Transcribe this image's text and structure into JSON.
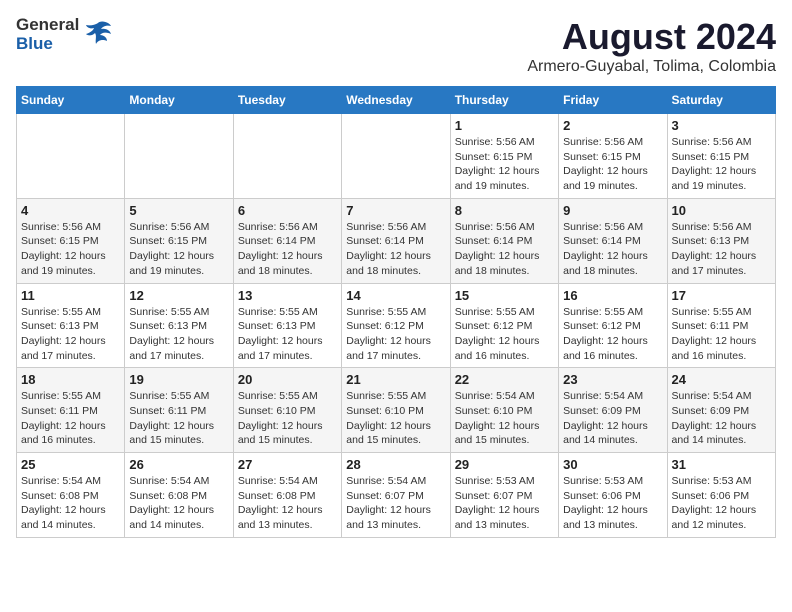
{
  "header": {
    "logo_general": "General",
    "logo_blue": "Blue",
    "month": "August 2024",
    "location": "Armero-Guyabal, Tolima, Colombia"
  },
  "weekdays": [
    "Sunday",
    "Monday",
    "Tuesday",
    "Wednesday",
    "Thursday",
    "Friday",
    "Saturday"
  ],
  "weeks": [
    [
      {
        "day": "",
        "info": ""
      },
      {
        "day": "",
        "info": ""
      },
      {
        "day": "",
        "info": ""
      },
      {
        "day": "",
        "info": ""
      },
      {
        "day": "1",
        "info": "Sunrise: 5:56 AM\nSunset: 6:15 PM\nDaylight: 12 hours\nand 19 minutes."
      },
      {
        "day": "2",
        "info": "Sunrise: 5:56 AM\nSunset: 6:15 PM\nDaylight: 12 hours\nand 19 minutes."
      },
      {
        "day": "3",
        "info": "Sunrise: 5:56 AM\nSunset: 6:15 PM\nDaylight: 12 hours\nand 19 minutes."
      }
    ],
    [
      {
        "day": "4",
        "info": "Sunrise: 5:56 AM\nSunset: 6:15 PM\nDaylight: 12 hours\nand 19 minutes."
      },
      {
        "day": "5",
        "info": "Sunrise: 5:56 AM\nSunset: 6:15 PM\nDaylight: 12 hours\nand 19 minutes."
      },
      {
        "day": "6",
        "info": "Sunrise: 5:56 AM\nSunset: 6:14 PM\nDaylight: 12 hours\nand 18 minutes."
      },
      {
        "day": "7",
        "info": "Sunrise: 5:56 AM\nSunset: 6:14 PM\nDaylight: 12 hours\nand 18 minutes."
      },
      {
        "day": "8",
        "info": "Sunrise: 5:56 AM\nSunset: 6:14 PM\nDaylight: 12 hours\nand 18 minutes."
      },
      {
        "day": "9",
        "info": "Sunrise: 5:56 AM\nSunset: 6:14 PM\nDaylight: 12 hours\nand 18 minutes."
      },
      {
        "day": "10",
        "info": "Sunrise: 5:56 AM\nSunset: 6:13 PM\nDaylight: 12 hours\nand 17 minutes."
      }
    ],
    [
      {
        "day": "11",
        "info": "Sunrise: 5:55 AM\nSunset: 6:13 PM\nDaylight: 12 hours\nand 17 minutes."
      },
      {
        "day": "12",
        "info": "Sunrise: 5:55 AM\nSunset: 6:13 PM\nDaylight: 12 hours\nand 17 minutes."
      },
      {
        "day": "13",
        "info": "Sunrise: 5:55 AM\nSunset: 6:13 PM\nDaylight: 12 hours\nand 17 minutes."
      },
      {
        "day": "14",
        "info": "Sunrise: 5:55 AM\nSunset: 6:12 PM\nDaylight: 12 hours\nand 17 minutes."
      },
      {
        "day": "15",
        "info": "Sunrise: 5:55 AM\nSunset: 6:12 PM\nDaylight: 12 hours\nand 16 minutes."
      },
      {
        "day": "16",
        "info": "Sunrise: 5:55 AM\nSunset: 6:12 PM\nDaylight: 12 hours\nand 16 minutes."
      },
      {
        "day": "17",
        "info": "Sunrise: 5:55 AM\nSunset: 6:11 PM\nDaylight: 12 hours\nand 16 minutes."
      }
    ],
    [
      {
        "day": "18",
        "info": "Sunrise: 5:55 AM\nSunset: 6:11 PM\nDaylight: 12 hours\nand 16 minutes."
      },
      {
        "day": "19",
        "info": "Sunrise: 5:55 AM\nSunset: 6:11 PM\nDaylight: 12 hours\nand 15 minutes."
      },
      {
        "day": "20",
        "info": "Sunrise: 5:55 AM\nSunset: 6:10 PM\nDaylight: 12 hours\nand 15 minutes."
      },
      {
        "day": "21",
        "info": "Sunrise: 5:55 AM\nSunset: 6:10 PM\nDaylight: 12 hours\nand 15 minutes."
      },
      {
        "day": "22",
        "info": "Sunrise: 5:54 AM\nSunset: 6:10 PM\nDaylight: 12 hours\nand 15 minutes."
      },
      {
        "day": "23",
        "info": "Sunrise: 5:54 AM\nSunset: 6:09 PM\nDaylight: 12 hours\nand 14 minutes."
      },
      {
        "day": "24",
        "info": "Sunrise: 5:54 AM\nSunset: 6:09 PM\nDaylight: 12 hours\nand 14 minutes."
      }
    ],
    [
      {
        "day": "25",
        "info": "Sunrise: 5:54 AM\nSunset: 6:08 PM\nDaylight: 12 hours\nand 14 minutes."
      },
      {
        "day": "26",
        "info": "Sunrise: 5:54 AM\nSunset: 6:08 PM\nDaylight: 12 hours\nand 14 minutes."
      },
      {
        "day": "27",
        "info": "Sunrise: 5:54 AM\nSunset: 6:08 PM\nDaylight: 12 hours\nand 13 minutes."
      },
      {
        "day": "28",
        "info": "Sunrise: 5:54 AM\nSunset: 6:07 PM\nDaylight: 12 hours\nand 13 minutes."
      },
      {
        "day": "29",
        "info": "Sunrise: 5:53 AM\nSunset: 6:07 PM\nDaylight: 12 hours\nand 13 minutes."
      },
      {
        "day": "30",
        "info": "Sunrise: 5:53 AM\nSunset: 6:06 PM\nDaylight: 12 hours\nand 13 minutes."
      },
      {
        "day": "31",
        "info": "Sunrise: 5:53 AM\nSunset: 6:06 PM\nDaylight: 12 hours\nand 12 minutes."
      }
    ]
  ]
}
